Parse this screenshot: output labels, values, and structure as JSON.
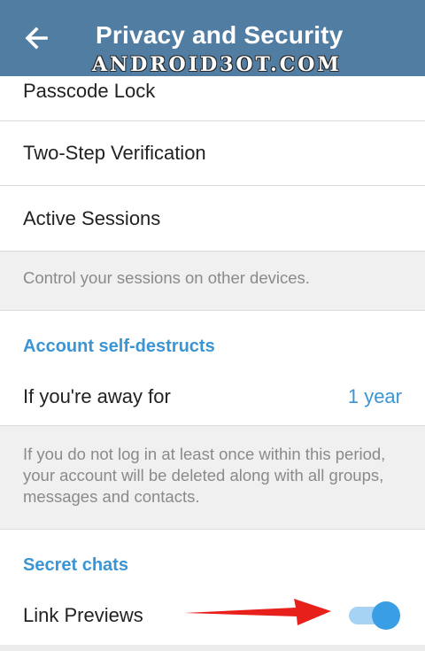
{
  "appbar": {
    "title": "Privacy and Security",
    "watermark": "ANDROID3OT.COM"
  },
  "security_items": [
    {
      "label": "Passcode Lock"
    },
    {
      "label": "Two-Step Verification"
    },
    {
      "label": "Active Sessions"
    }
  ],
  "sessions_info": "Control your sessions on other devices.",
  "self_destruct": {
    "header": "Account self-destructs",
    "row_label": "If you're away for",
    "row_value": "1 year",
    "info": "If you do not log in at least once within this period, your account will be deleted along with all groups, messages and contacts."
  },
  "secret_chats": {
    "header": "Secret chats",
    "link_previews_label": "Link Previews",
    "link_previews_enabled": true
  },
  "colors": {
    "appbar": "#527da3",
    "accent": "#3a95d5",
    "toggle_track": "#a6d2f4",
    "toggle_knob": "#3a9ee4",
    "annotation_arrow": "#e8201c"
  }
}
